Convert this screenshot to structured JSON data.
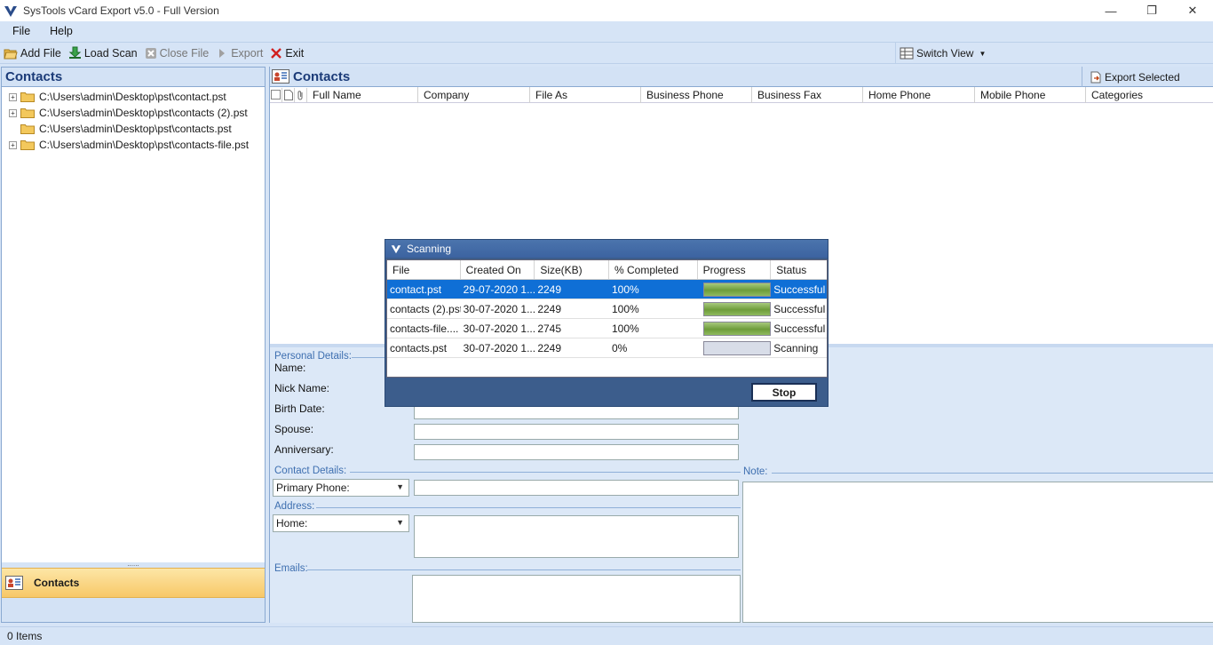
{
  "window": {
    "title": "SysTools  vCard Export v5.0  - Full Version",
    "minimize_glyph": "—",
    "restore_glyph": "❐",
    "close_glyph": "✕"
  },
  "menu": {
    "file": "File",
    "help": "Help"
  },
  "toolbar": {
    "add_file": "Add File",
    "load_scan": "Load Scan",
    "close_file": "Close File",
    "export": "Export",
    "exit": "Exit",
    "switch_view": "Switch View"
  },
  "left_panel": {
    "title": "Contacts",
    "tree": [
      {
        "path": "C:\\Users\\admin\\Desktop\\pst\\contact.pst",
        "expandable": true
      },
      {
        "path": "C:\\Users\\admin\\Desktop\\pst\\contacts (2).pst",
        "expandable": true
      },
      {
        "path": "C:\\Users\\admin\\Desktop\\pst\\contacts.pst",
        "expandable": false
      },
      {
        "path": "C:\\Users\\admin\\Desktop\\pst\\contacts-file.pst",
        "expandable": true
      }
    ],
    "splitter_dots": "......",
    "nav_contacts": "Contacts"
  },
  "right_panel": {
    "title": "Contacts",
    "export_selected": "Export Selected",
    "columns": [
      "Full Name",
      "Company",
      "File As",
      "Business Phone",
      "Business Fax",
      "Home Phone",
      "Mobile Phone",
      "Categories"
    ]
  },
  "details": {
    "personal_details": "Personal Details:",
    "name": "Name:",
    "nick_name": "Nick Name:",
    "birth_date": "Birth Date:",
    "spouse": "Spouse:",
    "anniversary": "Anniversary:",
    "contact_details": "Contact Details:",
    "primary_phone": "Primary Phone:",
    "address": "Address:",
    "home": "Home:",
    "emails": "Emails:",
    "note": "Note:"
  },
  "status": {
    "items": "0 Items"
  },
  "scanning_dialog": {
    "title": "Scanning",
    "columns": [
      "File",
      "Created On",
      "Size(KB)",
      "% Completed",
      "Progress",
      "Status"
    ],
    "rows": [
      {
        "file": "contact.pst",
        "created": "29-07-2020 1...",
        "size": "2249",
        "completed": "100%",
        "progress": 1.0,
        "status": "Successful",
        "selected": true
      },
      {
        "file": "contacts (2).pst",
        "created": "30-07-2020 1...",
        "size": "2249",
        "completed": "100%",
        "progress": 1.0,
        "status": "Successful",
        "selected": false
      },
      {
        "file": "contacts-file....",
        "created": "30-07-2020 1...",
        "size": "2745",
        "completed": "100%",
        "progress": 1.0,
        "status": "Successful",
        "selected": false
      },
      {
        "file": "contacts.pst",
        "created": "30-07-2020 1...",
        "size": "2249",
        "completed": "0%",
        "progress": 0.0,
        "status": "Scanning",
        "selected": false
      }
    ],
    "stop": "Stop"
  }
}
